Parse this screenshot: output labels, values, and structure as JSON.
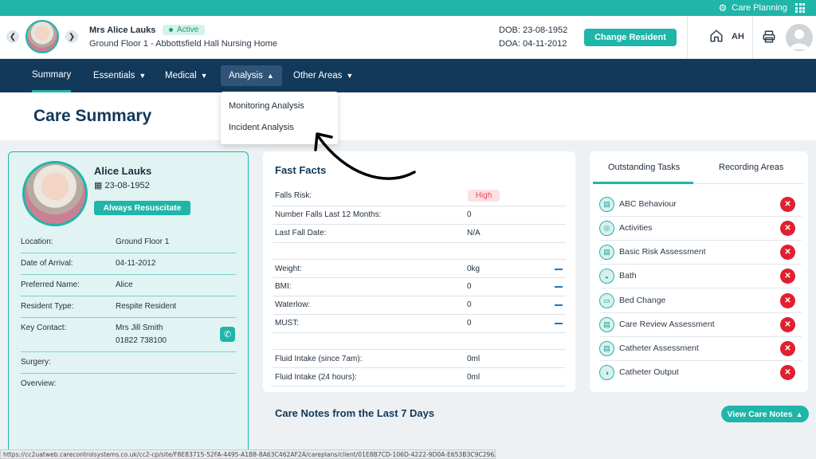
{
  "topbar": {
    "care_planning_label": "Care Planning",
    "icons": [
      "settings-icon",
      "apps-grid-icon"
    ]
  },
  "header": {
    "resident_name": "Mrs Alice Lauks",
    "status_badge": "Active",
    "location": "Ground Floor 1 - Abbottsfield Hall Nursing Home",
    "dob": "DOB: 23-08-1952",
    "doa": "DOA: 04-11-2012",
    "change_resident_label": "Change Resident",
    "user_initials": "AH",
    "icons": [
      "chevron-left-icon",
      "chevron-right-icon",
      "home-icon",
      "print-icon",
      "user-avatar"
    ]
  },
  "nav": {
    "items": [
      {
        "label": "Summary",
        "active": true,
        "has_dropdown": false
      },
      {
        "label": "Essentials",
        "active": false,
        "has_dropdown": true
      },
      {
        "label": "Medical",
        "active": false,
        "has_dropdown": true
      },
      {
        "label": "Analysis",
        "active": false,
        "has_dropdown": true,
        "open": true
      },
      {
        "label": "Other Areas",
        "active": false,
        "has_dropdown": true
      }
    ]
  },
  "analysis_dropdown": {
    "items": [
      "Monitoring Analysis",
      "Incident Analysis"
    ]
  },
  "page": {
    "title": "Care Summary"
  },
  "resident_card": {
    "name": "Alice Lauks",
    "dob": "23-08-1952",
    "resus_badge": "Always Resuscitate",
    "fields": [
      {
        "key": "Location:",
        "value": "Ground Floor 1"
      },
      {
        "key": "Date of Arrival:",
        "value": "04-11-2012"
      },
      {
        "key": "Preferred Name:",
        "value": "Alice"
      },
      {
        "key": "Resident Type:",
        "value": "Respite Resident"
      },
      {
        "key": "Key Contact:",
        "value": "Mrs Jill Smith",
        "value2": "01822 738100"
      },
      {
        "key": "Surgery:",
        "value": ""
      },
      {
        "key": "Overview:",
        "value": ""
      }
    ]
  },
  "fast_facts": {
    "title": "Fast Facts",
    "rows": [
      {
        "key": "Falls Risk:",
        "value": "High"
      },
      {
        "key": "Number Falls Last 12 Months:",
        "value": "0"
      },
      {
        "key": "Last Fall Date:",
        "value": "N/A"
      },
      {
        "key": "Weight:",
        "value": "0kg"
      },
      {
        "key": "BMI:",
        "value": "0"
      },
      {
        "key": "Waterlow:",
        "value": "0"
      },
      {
        "key": "MUST:",
        "value": "0"
      },
      {
        "key": "Fluid Intake (since 7am):",
        "value": "0ml"
      },
      {
        "key": "Fluid Intake (24 hours):",
        "value": "0ml"
      }
    ]
  },
  "tasks": {
    "tabs": [
      "Outstanding Tasks",
      "Recording Areas"
    ],
    "items": [
      "ABC Behaviour",
      "Activities",
      "Basic Risk Assessment",
      "Bath",
      "Bed Change",
      "Care Review Assessment",
      "Catheter Assessment",
      "Catheter Output"
    ]
  },
  "care_notes": {
    "title": "Care Notes from the Last 7 Days",
    "button_label": "View Care Notes"
  },
  "status_bar": {
    "url": "https://cc2uatweb.carecontrolsystems.co.uk/cc2-cp/site/F8E83715-52FA-4495-A1B8-8A63C462AF2A/careplans/client/01E8B7CD-106D-4222-9D0A-E653B3C9C296/summary#"
  }
}
